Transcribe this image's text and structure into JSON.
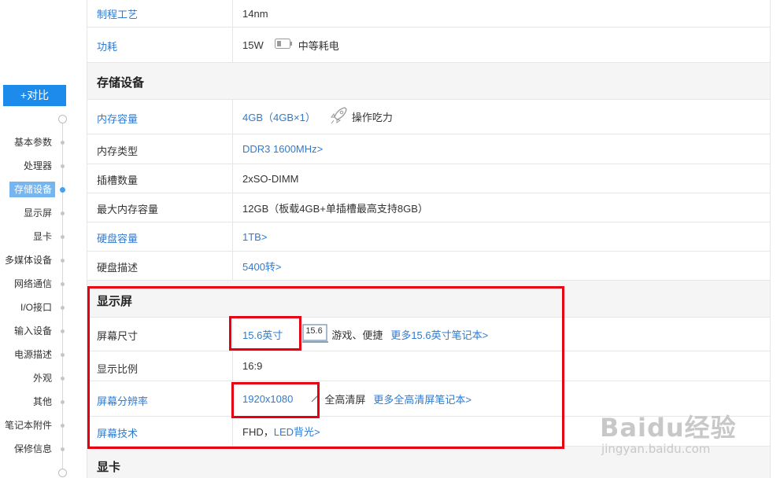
{
  "sidebar": {
    "compare_button": "+对比",
    "items": [
      {
        "label": "基本参数"
      },
      {
        "label": "处理器"
      },
      {
        "label": "存储设备"
      },
      {
        "label": "显示屏"
      },
      {
        "label": "显卡"
      },
      {
        "label": "多媒体设备"
      },
      {
        "label": "网络通信"
      },
      {
        "label": "I/O接口"
      },
      {
        "label": "输入设备"
      },
      {
        "label": "电源描述"
      },
      {
        "label": "外观"
      },
      {
        "label": "其他"
      },
      {
        "label": "笔记本附件"
      },
      {
        "label": "保修信息"
      }
    ],
    "active_item": "存储设备"
  },
  "specs": {
    "process": {
      "label": "制程工艺",
      "value": "14nm"
    },
    "power": {
      "label": "功耗",
      "value": "15W",
      "icon": "battery-icon",
      "note": "中等耗电"
    },
    "storage": {
      "title": "存储设备",
      "memory": {
        "label": "内存容量",
        "value": "4GB（4GB×1）",
        "icon": "rocket-icon",
        "note": "操作吃力"
      },
      "memory_type": {
        "label": "内存类型",
        "value": "DDR3 1600MHz>"
      },
      "slots": {
        "label": "插槽数量",
        "value": "2xSO-DIMM"
      },
      "max_memory": {
        "label": "最大内存容量",
        "value": "12GB（板载4GB+单插槽最高支持8GB）"
      },
      "disk": {
        "label": "硬盘容量",
        "value": "1TB>"
      },
      "disk_desc": {
        "label": "硬盘描述",
        "value": "5400转>"
      }
    },
    "display": {
      "title": "显示屏",
      "size": {
        "label": "屏幕尺寸",
        "value": "15.6英寸",
        "icon_text": "15.6",
        "note": "游戏、便捷",
        "more": "更多15.6英寸笔记本>"
      },
      "ratio": {
        "label": "显示比例",
        "value": "16:9"
      },
      "resolution": {
        "label": "屏幕分辨率",
        "value": "1920x1080",
        "note": "全高清屏",
        "more": "更多全高清屏笔记本>"
      },
      "tech": {
        "label": "屏幕技术",
        "value_plain": "FHD，",
        "value_link": "LED背光>"
      }
    },
    "gpu": {
      "title": "显卡"
    }
  },
  "colors": {
    "link": "#2f7bd0",
    "accent": "#1d8bec",
    "highlight": "#e60012"
  },
  "watermark": {
    "text": "Baidu经验",
    "url": "jingyan.baidu.com"
  }
}
